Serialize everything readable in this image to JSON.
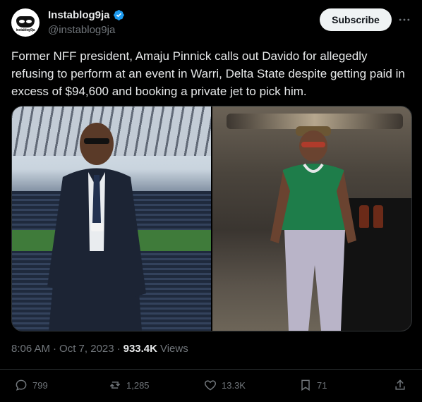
{
  "account": {
    "display_name": "Instablog9ja",
    "handle": "@instablog9ja",
    "avatar_brand": "instablog9ja",
    "verified_color": "#1d9bf0"
  },
  "header": {
    "subscribe_label": "Subscribe",
    "more_icon": "more-horizontal-icon"
  },
  "post": {
    "text": "Former NFF president, Amaju Pinnick calls out Davido for allegedly refusing to perform at an event in Warri, Delta State despite getting paid in excess of $94,600 and booking a private jet to pick him."
  },
  "meta": {
    "time": "8:06 AM",
    "date": "Oct 7, 2023",
    "views_count": "933.4K",
    "views_label": "Views"
  },
  "actions": {
    "replies": "799",
    "reposts": "1,285",
    "likes": "13.3K",
    "bookmarks": "71"
  },
  "colors": {
    "background": "#000000",
    "text": "#e7e9ea",
    "muted": "#71767b",
    "border": "#2f3336",
    "subscribe_bg": "#eff3f4"
  }
}
